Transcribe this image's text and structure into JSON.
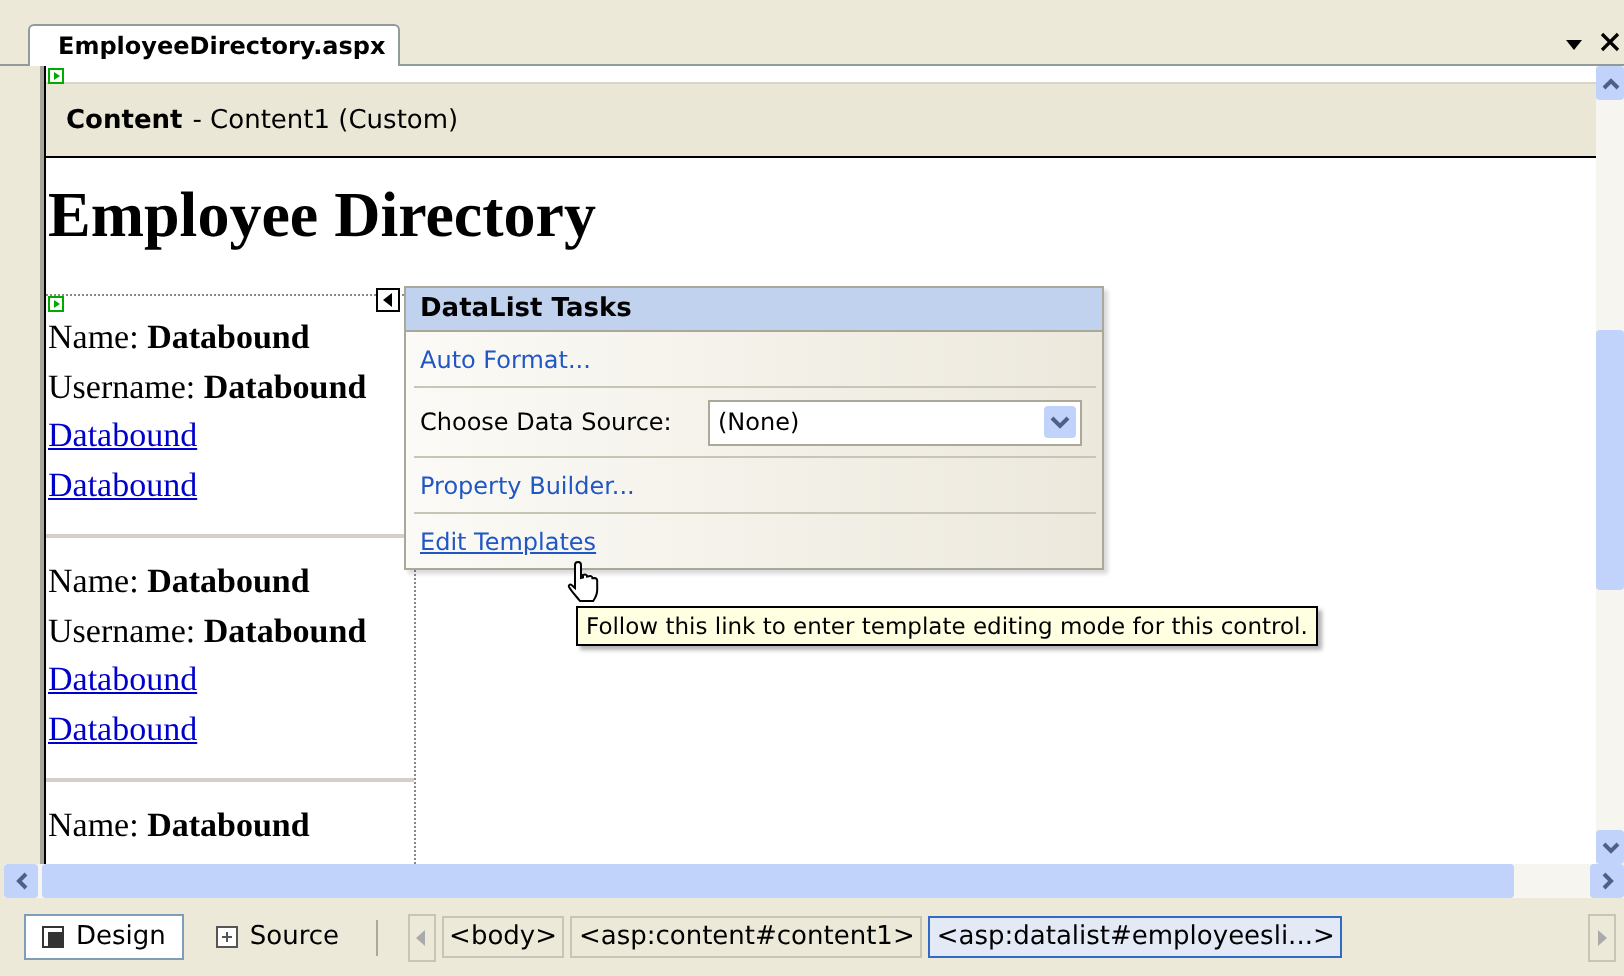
{
  "document_tab": {
    "title": "EmployeeDirectory.aspx",
    "selected": true
  },
  "content_header": {
    "label": "Content",
    "detail": "- Content1 (Custom)"
  },
  "heading": "Employee Directory",
  "items": [
    {
      "name_label": "Name:",
      "name_value": "Databound",
      "username_label": "Username:",
      "username_value": "Databound",
      "links": [
        "Databound",
        "Databound"
      ]
    },
    {
      "name_label": "Name:",
      "name_value": "Databound",
      "username_label": "Username:",
      "username_value": "Databound",
      "links": [
        "Databound",
        "Databound"
      ]
    },
    {
      "name_label": "Name:",
      "name_value": "Databound"
    }
  ],
  "smart_tag": {
    "title": "DataList Tasks",
    "rows": [
      {
        "kind": "link",
        "label": "Auto Format...",
        "hovered": false
      },
      {
        "kind": "select",
        "label": "Choose Data Source:",
        "value": "(None)"
      },
      {
        "kind": "link",
        "label": "Property Builder...",
        "hovered": false
      },
      {
        "kind": "link",
        "label": "Edit Templates",
        "hovered": true
      }
    ]
  },
  "tooltip": "Follow this link to enter template editing mode for this control.",
  "view_tabs": [
    {
      "label": "Design",
      "selected": true
    },
    {
      "label": "Source",
      "selected": false
    }
  ],
  "breadcrumbs": [
    {
      "label": "<body>",
      "selected": false
    },
    {
      "label": "<asp:content#content1>",
      "selected": false
    },
    {
      "label": "<asp:datalist#employeesli...>",
      "selected": true
    }
  ]
}
